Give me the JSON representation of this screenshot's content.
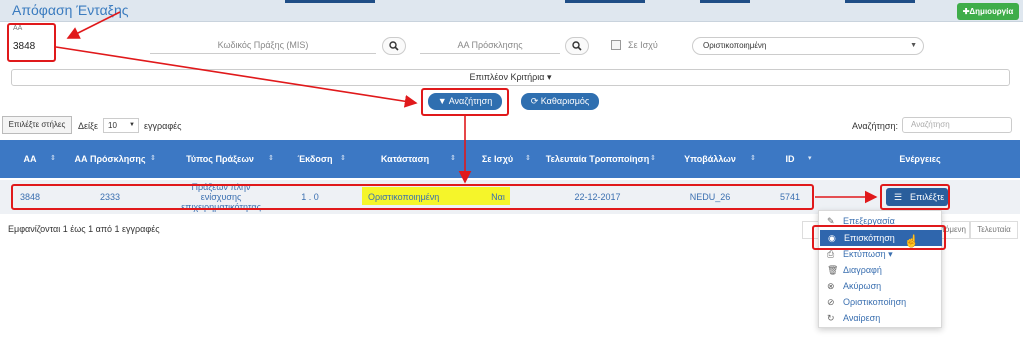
{
  "page": {
    "title": "Απόφαση Ένταξης",
    "create_label": "Δημιουργία",
    "create_icon": "plus-icon"
  },
  "filters": {
    "aa_label": "ΑΑ",
    "aa_value": "3848",
    "mis_placeholder": "Κωδικός Πράξης (MIS)",
    "call_placeholder": "ΑΑ Πρόσκλησης",
    "in_force_label": "Σε Ισχύ",
    "status_value": "Οριστικοποιημένη",
    "more_criteria": "Επιπλέον Κριτήρια"
  },
  "actions": {
    "search_label": "Αναζήτηση",
    "clear_label": "Καθαρισμός"
  },
  "table_controls": {
    "choose_columns": "Επιλέξτε στήλες",
    "show_label": "Δείξε",
    "page_length": "10",
    "entries_label": "εγγραφές",
    "search_label": "Αναζήτηση:",
    "search_placeholder": "Αναζήτηση"
  },
  "table": {
    "headers": [
      "ΑΑ",
      "ΑΑ Πρόσκλησης",
      "Τύπος Πράξεων",
      "Έκδοση",
      "Κατάσταση",
      "Σε Ισχύ",
      "Τελευταία Τροποποίηση",
      "Υποβάλλων",
      "ID",
      "Ενέργειες"
    ],
    "rows": [
      {
        "aa": "3848",
        "call_aa": "2333",
        "type": "Πράξεων πλην ενίσχυσης επιχειρηματικότητας",
        "version": "1 . 0",
        "status": "Οριστικοποιημένη",
        "in_force": "Ναι",
        "last_modified": "22-12-2017",
        "submitter": "NEDU_26",
        "id": "5741",
        "action_label": "Επιλέξτε"
      }
    ]
  },
  "footer": {
    "info": "Εμφανίζονται 1 έως 1 από 1 εγγραφές",
    "next_label": "Επόμενη",
    "last_label": "Τελευταία"
  },
  "actions_menu": {
    "items": [
      {
        "label": "Επεξεργασία",
        "icon": "edit-icon"
      },
      {
        "label": "Επισκόπηση",
        "icon": "eye-icon",
        "active": true
      },
      {
        "label": "Εκτύπωση",
        "icon": "print-icon"
      },
      {
        "label": "Διαγραφή",
        "icon": "trash-icon"
      },
      {
        "label": "Ακύρωση",
        "icon": "cancel-icon"
      },
      {
        "label": "Οριστικοποίηση",
        "icon": "check-circle-icon"
      },
      {
        "label": "Αναίρεση",
        "icon": "undo-icon"
      }
    ]
  },
  "colors": {
    "header_blue": "#3c78c4",
    "button_blue": "#2f6fb0",
    "create_green": "#3fad4a",
    "annotation_red": "#e0191b",
    "highlight_yellow": "#f5f52a"
  }
}
